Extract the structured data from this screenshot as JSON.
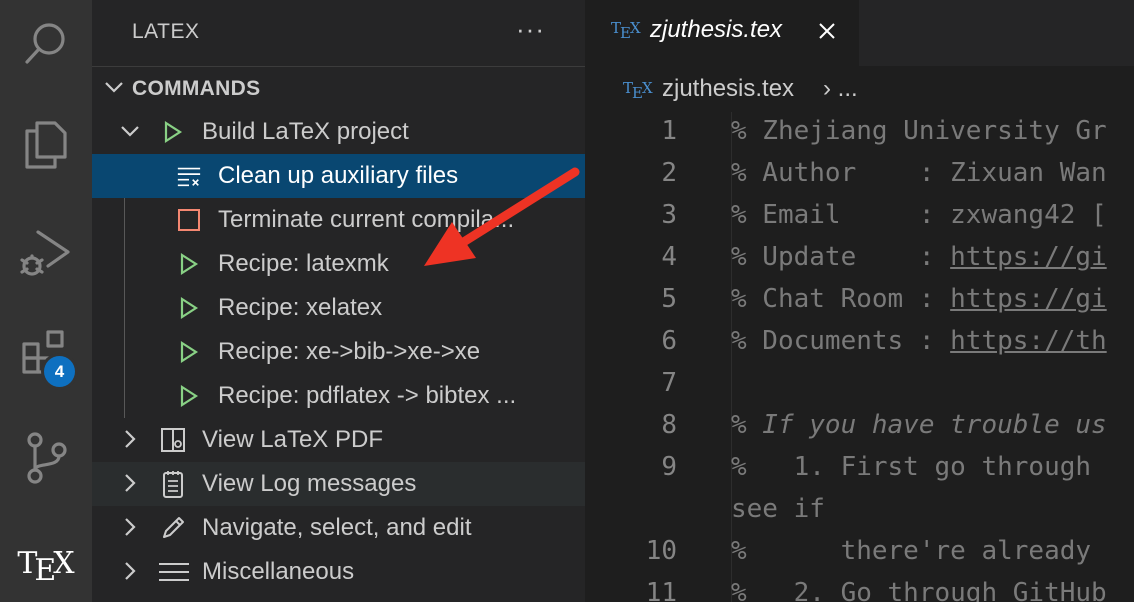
{
  "activity_bar": {
    "icons": [
      "search-icon",
      "explorer-icon",
      "run-debug-icon",
      "extensions-icon",
      "source-control-icon",
      "tex-icon"
    ],
    "extensions_badge": "4",
    "tex_label_t": "T",
    "tex_label_e": "E",
    "tex_label_x": "X"
  },
  "sidebar": {
    "title": "LATEX",
    "more": "···",
    "section": "COMMANDS",
    "items": [
      {
        "label": "Build LaTeX project",
        "icon": "play-icon",
        "expanded": true
      },
      {
        "label": "Clean up auxiliary files",
        "icon": "clear-list-icon",
        "selected": true
      },
      {
        "label": "Terminate current compila...",
        "icon": "stop-icon"
      },
      {
        "label": "Recipe: latexmk",
        "icon": "play-icon"
      },
      {
        "label": "Recipe: xelatex",
        "icon": "play-icon"
      },
      {
        "label": "Recipe: xe->bib->xe->xe",
        "icon": "play-icon"
      },
      {
        "label": "Recipe: pdflatex -> bibtex ...",
        "icon": "play-icon"
      },
      {
        "label": "View LaTeX PDF",
        "icon": "pdf-preview-icon"
      },
      {
        "label": "View Log messages",
        "icon": "notepad-icon"
      },
      {
        "label": "Navigate, select, and edit",
        "icon": "edit-icon"
      },
      {
        "label": "Miscellaneous",
        "icon": "menu-icon"
      }
    ]
  },
  "editor": {
    "tab": {
      "filename": "zjuthesis.tex",
      "tex_icon": "TEX"
    },
    "breadcrumb": {
      "filename": "zjuthesis.tex",
      "separator": "›",
      "ellipsis": "..."
    },
    "lines": [
      {
        "n": "1",
        "text": "% Zhejiang University Gr"
      },
      {
        "n": "2",
        "text": "% Author    : Zixuan Wan"
      },
      {
        "n": "3",
        "text": "% Email     : zxwang42 ["
      },
      {
        "n": "4",
        "pre": "% Update    : ",
        "link": "https://gi"
      },
      {
        "n": "5",
        "pre": "% Chat Room : ",
        "link": "https://gi"
      },
      {
        "n": "6",
        "pre": "% Documents : ",
        "link": "https://th"
      },
      {
        "n": "7",
        "text": ""
      },
      {
        "n": "8",
        "text": "% If you have trouble us"
      },
      {
        "n": "9",
        "text": "%   1. First go through"
      },
      {
        "n": "",
        "text": "see if"
      },
      {
        "n": "10",
        "text": "%      there're already"
      },
      {
        "n": "11",
        "text": "%   2. Go through GitHub"
      }
    ]
  },
  "colors": {
    "accent": "#0e70c0",
    "selection": "#094771",
    "play_green": "#89d185",
    "stop_orange": "#f48771",
    "annotation_arrow": "#ee3324"
  }
}
